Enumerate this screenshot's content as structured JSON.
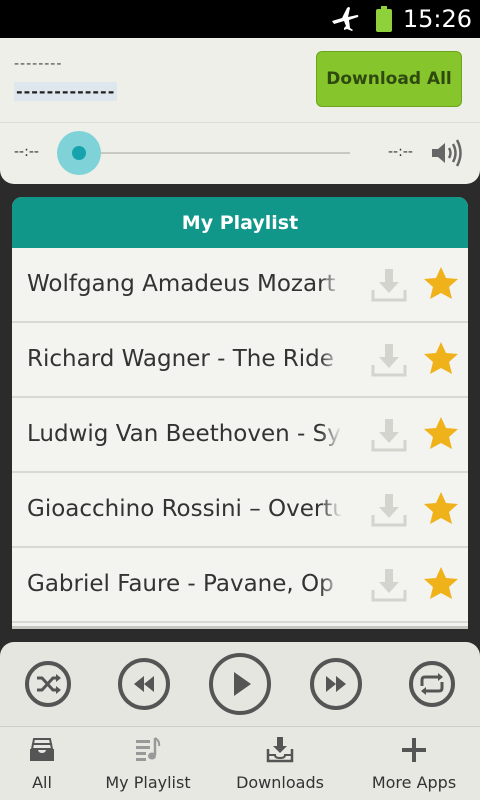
{
  "status_bar": {
    "time": "15:26",
    "icons": [
      "airplane-mode-icon",
      "battery-icon"
    ]
  },
  "player": {
    "track_title": "--------",
    "track_artist": "-------------",
    "download_all_label": "Download All",
    "elapsed": "--:--",
    "duration": "--:--",
    "progress": 0
  },
  "playlist": {
    "title": "My Playlist",
    "items": [
      {
        "title": "Wolfgang Amadeus Mozart"
      },
      {
        "title": "Richard Wagner - The Ride of"
      },
      {
        "title": "Ludwig Van Beethoven - Symp"
      },
      {
        "title": "Gioacchino Rossini – Overtur"
      },
      {
        "title": "Gabriel Faure - Pavane, Op"
      }
    ]
  },
  "controls": [
    "shuffle-icon",
    "rewind-icon",
    "play-icon",
    "fast-forward-icon",
    "repeat-icon"
  ],
  "nav": {
    "items": [
      {
        "label": "All",
        "icon": "inbox-icon"
      },
      {
        "label": "My Playlist",
        "icon": "playlist-icon"
      },
      {
        "label": "Downloads",
        "icon": "download-tray-icon"
      },
      {
        "label": "More Apps",
        "icon": "plus-icon"
      }
    ]
  },
  "colors": {
    "accent_teal": "#11968a",
    "download_green": "#86c52c",
    "star_gold": "#f0b21a",
    "seek_thumb": "#7fd3d8"
  }
}
